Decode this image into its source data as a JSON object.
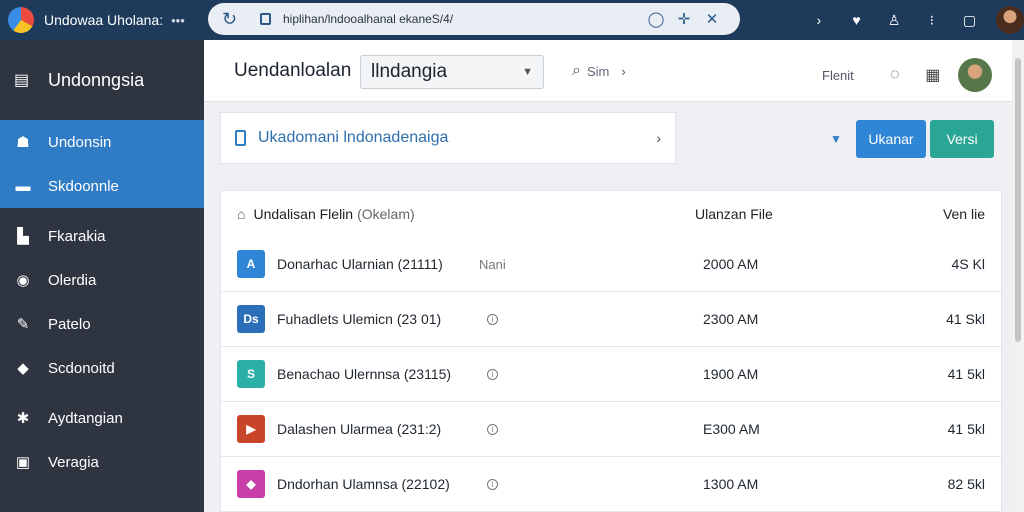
{
  "browser": {
    "tab_title": "Undowaa Uholana:",
    "url": "hiplihan/lndooalhanal ekaneS/4/",
    "more_icon": "more-dots-icon",
    "nav_icons": [
      "reload-icon",
      "lock-icon",
      "shield-icon",
      "cross-star-icon",
      "close-icon"
    ],
    "right_icons": [
      "chevron-right-icon",
      "heart-shield-icon",
      "person-icon",
      "more-dots-icon",
      "square-icon"
    ]
  },
  "sidebar": {
    "brand": "Undonngsia",
    "items": [
      {
        "label": "Undonsin",
        "icon": "person-icon",
        "active": true
      },
      {
        "label": "Skdoonnle",
        "icon": "list-icon",
        "active": true
      },
      {
        "label": "Fkarakia",
        "icon": "bag-icon",
        "active": false
      },
      {
        "label": "Olerdia",
        "icon": "clock-icon",
        "active": false
      },
      {
        "label": "Patelo",
        "icon": "pen-icon",
        "active": false
      },
      {
        "label": "Scdonoitd",
        "icon": "chat-icon",
        "active": false
      },
      {
        "label": "Aydtangian",
        "icon": "gear-icon",
        "active": false
      },
      {
        "label": "Veragia",
        "icon": "window-icon",
        "active": false
      }
    ]
  },
  "topbar": {
    "title": "Uendanloalan",
    "select_value": "llndangia",
    "search_label": "Sim",
    "right_label": "Flenit"
  },
  "actionbar": {
    "text": "Ukadomani lndonadenaiga",
    "btn_primary": "Ukanar",
    "btn_secondary": "Versi"
  },
  "table": {
    "columns": {
      "name": "Undalisan Flelin",
      "name_sub": "(Okelam)",
      "time": "Ulanzan File",
      "size": "Ven lie"
    },
    "rows": [
      {
        "name": "Donarhac Ularnian (21111)",
        "tag": "Nani",
        "time": "2000 AM",
        "size": "4S Kl",
        "icon_color": "#2f86d6",
        "icon_glyph": "A"
      },
      {
        "name": "Fuhadlets Ulemicn (23 01)",
        "tag": "",
        "time": "2300 AM",
        "size": "41 Skl",
        "icon_color": "#2a6fb8",
        "icon_glyph": "Ds"
      },
      {
        "name": "Benachao Ulernnsa (23115)",
        "tag": "",
        "time": "1900 AM",
        "size": "41 5kl",
        "icon_color": "#2bb0a8",
        "icon_glyph": "S"
      },
      {
        "name": "Dalashen Ularmea (231:2)",
        "tag": "",
        "time": "E300 AM",
        "size": "41 5kl",
        "icon_color": "#c9452a",
        "icon_glyph": "▶"
      },
      {
        "name": "Dndorhan Ulamnsa (22102)",
        "tag": "",
        "time": "1300 AM",
        "size": "82 5kl",
        "icon_color": "#c93ea8",
        "icon_glyph": "◆"
      }
    ]
  }
}
